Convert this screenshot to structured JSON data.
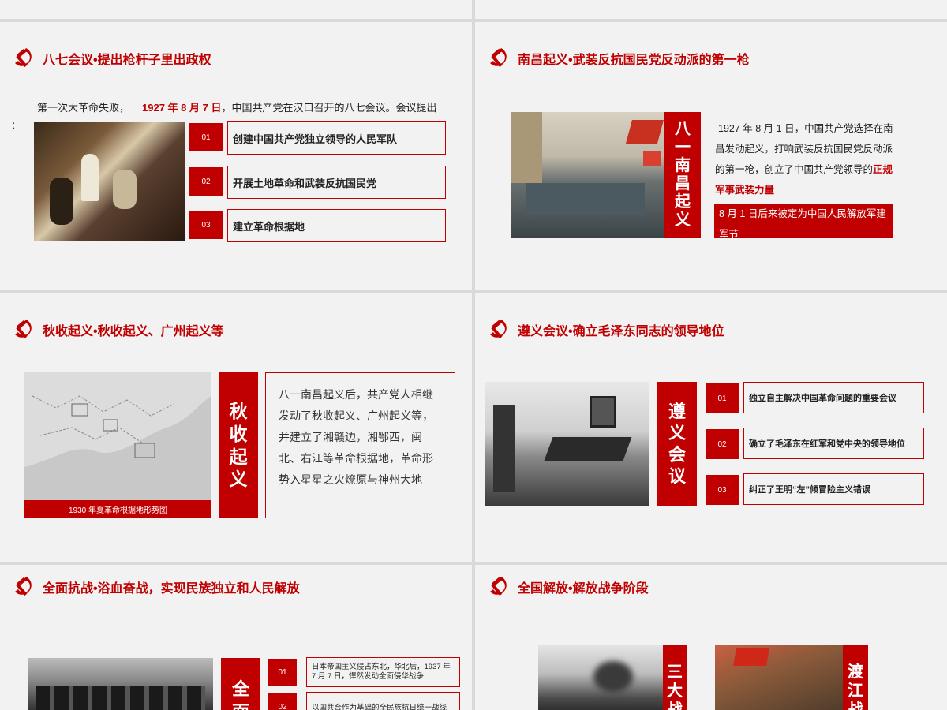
{
  "colors": {
    "accent": "#c00000",
    "slide_bg": "#f2f2f2",
    "gutter": "#d9d9d9"
  },
  "icon": "hammer-sickle-icon",
  "slides": {
    "s1": {
      "title": "八七会议•提出枪杆子里出政权",
      "intro_a": "第一次大革命失败，",
      "intro_date": "1927 年 8 月 7 日",
      "intro_b": "，中国共产党在汉口召开的八七会议。会议提出",
      "colon": "：",
      "items": [
        {
          "num": "01",
          "text": "创建中国共产党独立领导的人民军队"
        },
        {
          "num": "02",
          "text": "开展土地革命和武装反抗国民党"
        },
        {
          "num": "03",
          "text": "建立革命根据地"
        }
      ]
    },
    "s2": {
      "title": "南昌起义•武装反抗国民党反动派的第一枪",
      "label": [
        "八",
        "一",
        "南",
        "昌",
        "起",
        "义"
      ],
      "para": "1927 年 8 月 1 日，中国共产党选择在南昌发动起义，打响武装反抗国民党反动派的第一枪，创立了中国共产党领导的",
      "para_hl": "正规军事武装力量",
      "note": "8 月 1 日后来被定为中国人民解放军建军节"
    },
    "s3": {
      "title": "秋收起义•秋收起义、广州起义等",
      "map_caption": "1930 年夏革命根据地形势图",
      "label": [
        "秋",
        "收",
        "起",
        "义"
      ],
      "para": "八一南昌起义后，共产党人相继发动了秋收起义、广州起义等，并建立了湘赣边，湘鄂西，闽北、右江等革命根据地，革命形势入星星之火燎原与神州大地"
    },
    "s4": {
      "title": "遵义会议•确立毛泽东同志的领导地位",
      "label": [
        "遵",
        "义",
        "会",
        "议"
      ],
      "items": [
        {
          "num": "01",
          "text": "独立自主解决中国革命问题的重要会议"
        },
        {
          "num": "02",
          "text": "确立了毛泽东在红军和党中央的领导地位"
        },
        {
          "num": "03",
          "text": "纠正了王明“左”倾冒险主义错误"
        }
      ]
    },
    "s5": {
      "title": "全面抗战•浴血奋战，实现民族独立和人民解放",
      "label": [
        "全",
        "面"
      ],
      "items": [
        {
          "num": "01",
          "text": "日本帝国主义侵占东北，华北后，1937 年 7 月 7 日，悍然发动全面侵华战争"
        },
        {
          "num": "02",
          "text": "以国共合作为基础的全民族抗日统一战线"
        }
      ]
    },
    "s6": {
      "title": "全国解放•解放战争阶段",
      "label_a": [
        "三",
        "大",
        "战"
      ],
      "label_b": [
        "渡",
        "江",
        "战"
      ]
    }
  }
}
